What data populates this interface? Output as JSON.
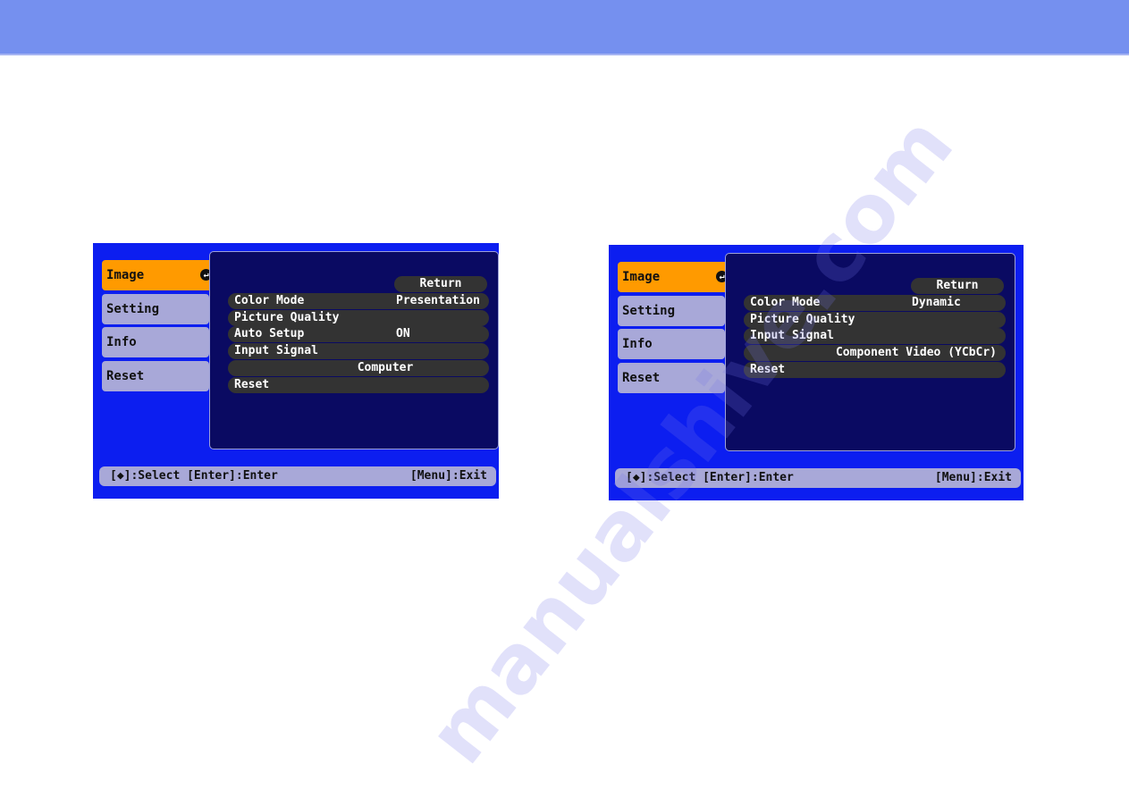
{
  "colors": {
    "header": "#7590ef",
    "osd_background": "#0c1ef0",
    "active_tab": "#ff9a00",
    "inactive_tab": "#a8a8d8",
    "content_panel": "#0a0a62",
    "row": "#333333"
  },
  "watermark": "manualshive.com",
  "screens": [
    {
      "tabs": [
        {
          "label": "Image",
          "active": true,
          "icon": "enter-icon"
        },
        {
          "label": "Setting"
        },
        {
          "label": "Info"
        },
        {
          "label": "Reset"
        }
      ],
      "return_label": "Return",
      "rows": [
        {
          "label": "Color Mode",
          "value": "Presentation"
        },
        {
          "label": "Picture Quality",
          "value": ""
        },
        {
          "label": "Auto Setup",
          "value": "ON"
        },
        {
          "label": "Input Signal",
          "value": ""
        },
        {
          "label": "",
          "value": "Computer"
        },
        {
          "label": "Reset",
          "value": ""
        }
      ],
      "footer": {
        "left": "[◆]:Select [Enter]:Enter",
        "right": "[Menu]:Exit"
      }
    },
    {
      "tabs": [
        {
          "label": "Image",
          "active": true,
          "icon": "enter-icon"
        },
        {
          "label": "Setting"
        },
        {
          "label": "Info"
        },
        {
          "label": "Reset"
        }
      ],
      "return_label": "Return",
      "rows": [
        {
          "label": "Color Mode",
          "value": "Dynamic"
        },
        {
          "label": "Picture Quality",
          "value": ""
        },
        {
          "label": "Input Signal",
          "value": ""
        },
        {
          "label": "",
          "value": "Component Video (YCbCr)"
        },
        {
          "label": "Reset",
          "value": ""
        }
      ],
      "footer": {
        "left": "[◆]:Select [Enter]:Enter",
        "right": "[Menu]:Exit"
      }
    }
  ]
}
